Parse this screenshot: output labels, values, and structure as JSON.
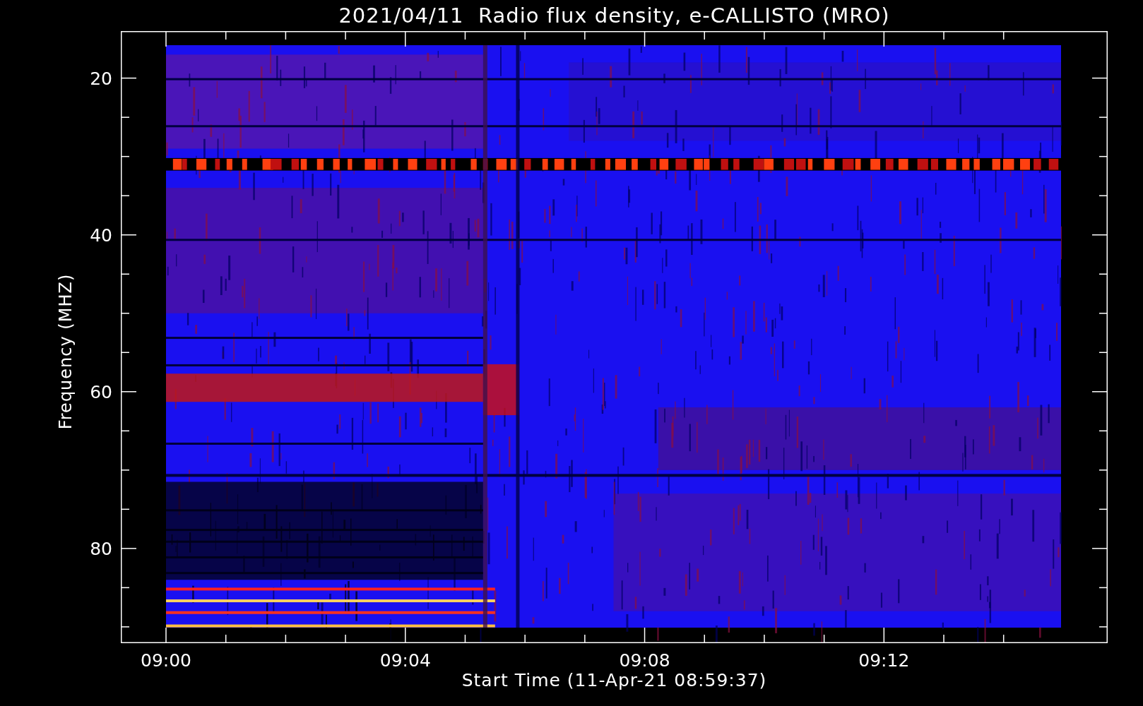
{
  "plot": {
    "title": "2021/04/11  Radio flux density, e-CALLISTO (MRO)",
    "ylabel": "Frequency (MHZ)",
    "xlabel": "Start Time (11-Apr-21 08:59:37)",
    "yticks": [
      "20",
      "40",
      "60",
      "80"
    ],
    "xticks": [
      "09:00",
      "09:04",
      "09:08",
      "09:12"
    ]
  }
}
